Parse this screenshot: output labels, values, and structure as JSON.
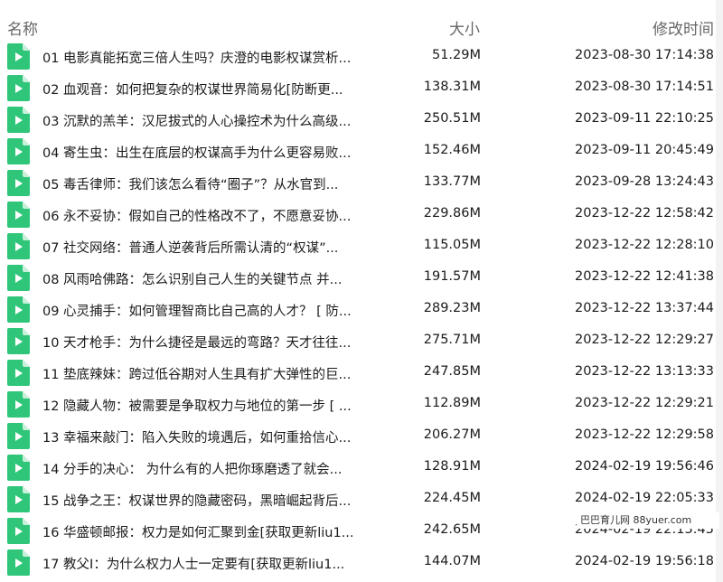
{
  "header": {
    "name": "名称",
    "size": "大小",
    "modified": "修改时间"
  },
  "colors": {
    "icon_green": "#2fc67a",
    "icon_fold": "#c9f0db"
  },
  "icon": "video-file-icon",
  "files": [
    {
      "name": "01 电影真能拓宽三倍人生吗？庆澄的电影权谋赏析...",
      "size": "51.29M",
      "modified": "2023-08-30 17:14:38"
    },
    {
      "name": "02 血观音：如何把复杂的权谋世界简易化[防断更...",
      "size": "138.31M",
      "modified": "2023-08-30 17:14:51"
    },
    {
      "name": "03 沉默的羔羊：汉尼拔式的人心操控术为什么高级...",
      "size": "250.51M",
      "modified": "2023-09-11 22:10:25"
    },
    {
      "name": "04 寄生虫：出生在底层的权谋高手为什么更容易败...",
      "size": "152.46M",
      "modified": "2023-09-11 20:45:49"
    },
    {
      "name": "05 毒舌律师：我们该怎么看待“圈子”？从水官到...",
      "size": "133.77M",
      "modified": "2023-09-28 13:24:43"
    },
    {
      "name": "06 永不妥协：假如自己的性格改不了，不愿意妥协...",
      "size": "229.86M",
      "modified": "2023-12-22 12:58:42"
    },
    {
      "name": "07 社交网络：普通人逆袭背后所需认清的“权谋”...",
      "size": "115.05M",
      "modified": "2023-12-22 12:28:10"
    },
    {
      "name": "08 风雨哈佛路：怎么识别自己人生的关键节点 并...",
      "size": "191.57M",
      "modified": "2023-12-22 12:41:38"
    },
    {
      "name": "09 心灵捕手：如何管理智商比自己高的人才？ [ 防...",
      "size": "289.23M",
      "modified": "2023-12-22 13:37:44"
    },
    {
      "name": "10 天才枪手：为什么捷径是最远的弯路？天才往往...",
      "size": "275.71M",
      "modified": "2023-12-22 12:29:27"
    },
    {
      "name": "11 垫底辣妹：跨过低谷期对人生具有扩大弹性的巨...",
      "size": "247.85M",
      "modified": "2023-12-22 13:13:33"
    },
    {
      "name": "12 隐藏人物：被需要是争取权力与地位的第一步 [ ...",
      "size": "112.89M",
      "modified": "2023-12-22 12:29:21"
    },
    {
      "name": "13 幸福来敲门：陷入失败的境遇后，如何重拾信心...",
      "size": "206.27M",
      "modified": "2023-12-22 12:29:58"
    },
    {
      "name": "14 分手的决心： 为什么有的人把你琢磨透了就会...",
      "size": "128.91M",
      "modified": "2024-02-19 19:56:46"
    },
    {
      "name": "15 战争之王：权谋世界的隐藏密码，黑暗崛起背后...",
      "size": "224.45M",
      "modified": "2024-02-19 22:05:33"
    },
    {
      "name": "16 华盛顿邮报：权力是如何汇聚到金[获取更新liu1...",
      "size": "242.65M",
      "modified": "2024-02-19 22:13:45"
    },
    {
      "name": "17 教父Ⅰ：为什么权力人士一定要有[获取更新liu1...",
      "size": "144.07M",
      "modified": "2024-02-19 19:56:18"
    }
  ],
  "watermark": "巴巴育儿网 88yuer.com"
}
